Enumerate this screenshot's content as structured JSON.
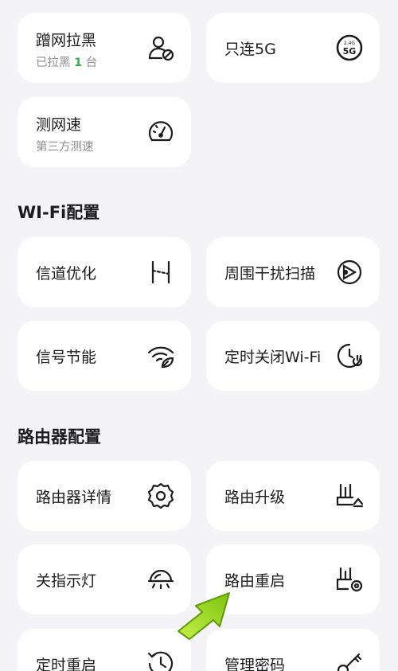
{
  "top": {
    "blacklist": {
      "title": "蹭网拉黑",
      "sub_prefix": "已拉黑 ",
      "sub_count": "1",
      "sub_suffix": " 台"
    },
    "only5g": {
      "title": "只连5G",
      "icon_text_top": "2.4G",
      "icon_text_main": "5G"
    },
    "speedtest": {
      "title": "测网速",
      "sub": "第三方测速"
    }
  },
  "wifi_section": {
    "title": "WI-Fi配置",
    "items": [
      {
        "title": "信道优化",
        "icon": "channel-icon"
      },
      {
        "title": "周围干扰扫描",
        "icon": "radar-scan-icon"
      },
      {
        "title": "信号节能",
        "icon": "wifi-leaf-icon"
      },
      {
        "title": "定时关闭Wi-Fi",
        "icon": "timer-power-icon"
      }
    ]
  },
  "router_section": {
    "title": "路由器配置",
    "items": [
      {
        "title": "路由器详情",
        "icon": "gear-icon"
      },
      {
        "title": "路由升级",
        "icon": "router-upgrade-icon"
      },
      {
        "title": "关指示灯",
        "icon": "indicator-light-icon"
      },
      {
        "title": "路由重启",
        "icon": "router-restart-icon"
      },
      {
        "title": "定时重启",
        "icon": "clock-restart-icon"
      },
      {
        "title": "管理密码",
        "icon": "key-icon"
      }
    ]
  },
  "colors": {
    "background": "#f4f4f6",
    "card": "#ffffff",
    "text": "#1c1c1e",
    "subtext": "#8e8e93",
    "highlight": "#34b24a",
    "arrow": "#9bd21e"
  }
}
